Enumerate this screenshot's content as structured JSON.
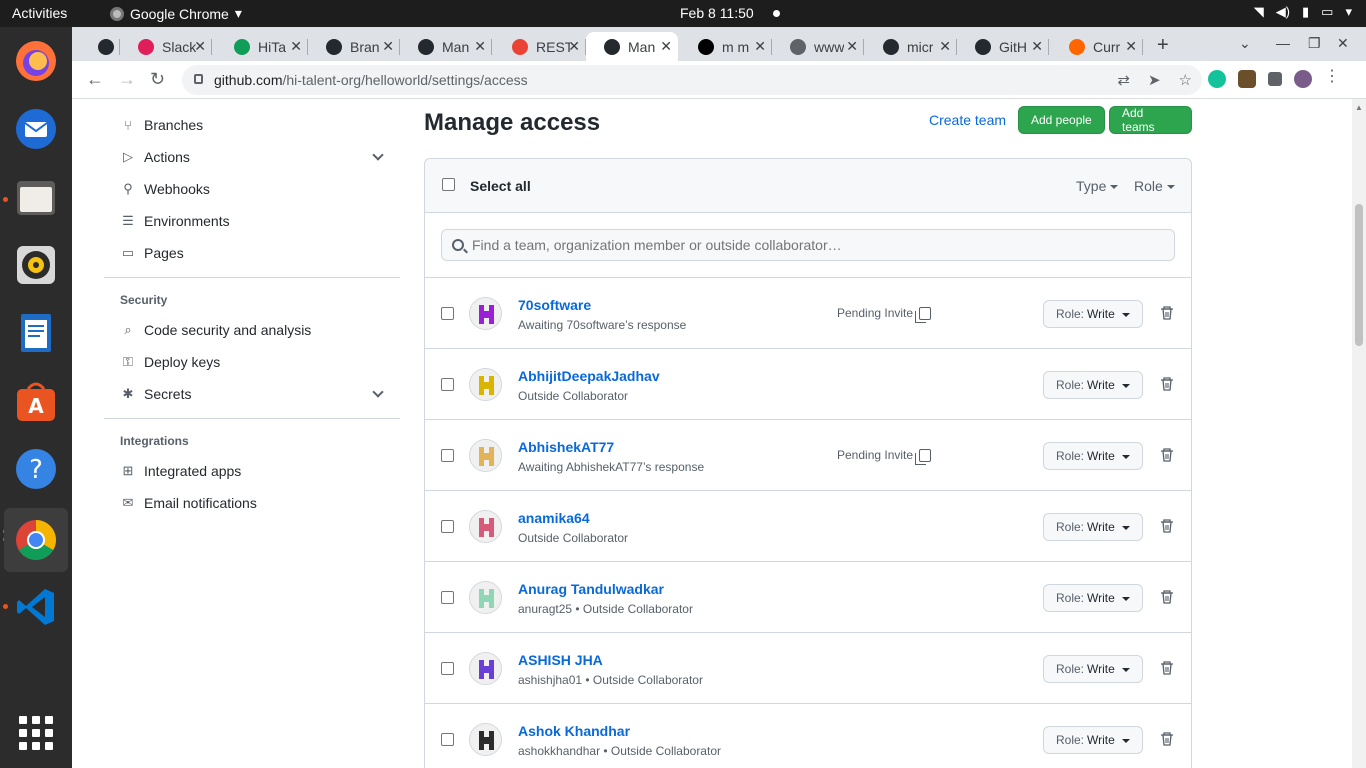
{
  "system": {
    "activities": "Activities",
    "app_name": "Google Chrome",
    "clock": "Feb 8  11:50"
  },
  "browser": {
    "tabs": [
      {
        "title": "",
        "icon": "github-icon",
        "color": "#24292f"
      },
      {
        "title": "Slack",
        "icon": "slack-icon",
        "color": "#e01e5a"
      },
      {
        "title": "HiTa",
        "icon": "sheets-icon",
        "color": "#0f9d58"
      },
      {
        "title": "Bran",
        "icon": "github-icon",
        "color": "#24292f"
      },
      {
        "title": "Man",
        "icon": "github-icon",
        "color": "#24292f"
      },
      {
        "title": "REST",
        "icon": "gmail-icon",
        "color": "#ea4335"
      },
      {
        "title": "Man",
        "icon": "github-icon",
        "color": "#24292f",
        "active": true
      },
      {
        "title": "m m",
        "icon": "m-icon",
        "color": "#000000"
      },
      {
        "title": "www",
        "icon": "globe-icon",
        "color": "#5f6368"
      },
      {
        "title": "micr",
        "icon": "github-icon",
        "color": "#24292f"
      },
      {
        "title": "GitH",
        "icon": "github-icon",
        "color": "#24292f"
      },
      {
        "title": "Curr",
        "icon": "ycombinator-icon",
        "color": "#ff6600"
      }
    ],
    "url_host": "github.com",
    "url_path": "/hi-talent-org/helloworld/settings/access"
  },
  "sidebar": {
    "items_top": [
      {
        "label": "Branches",
        "icon": "branch-icon"
      },
      {
        "label": "Actions",
        "icon": "play-icon",
        "expandable": true
      },
      {
        "label": "Webhooks",
        "icon": "webhook-icon"
      },
      {
        "label": "Environments",
        "icon": "server-icon"
      },
      {
        "label": "Pages",
        "icon": "browser-icon"
      }
    ],
    "security_heading": "Security",
    "security_items": [
      {
        "label": "Code security and analysis",
        "icon": "codescan-icon"
      },
      {
        "label": "Deploy keys",
        "icon": "key-icon"
      },
      {
        "label": "Secrets",
        "icon": "asterisk-icon",
        "expandable": true
      }
    ],
    "integrations_heading": "Integrations",
    "integrations_items": [
      {
        "label": "Integrated apps",
        "icon": "apps-icon"
      },
      {
        "label": "Email notifications",
        "icon": "mail-icon"
      }
    ]
  },
  "main": {
    "title": "Manage access",
    "create_team": "Create team",
    "add_people": "Add people",
    "add_teams": "Add teams",
    "select_all": "Select all",
    "filter_type": "Type",
    "filter_role": "Role",
    "search_placeholder": "Find a team, organization member or outside collaborator…",
    "pending_label": "Pending Invite",
    "role_prefix": "Role:",
    "members": [
      {
        "name": "70software",
        "sub": "Awaiting 70software’s response",
        "pending": true,
        "role": "Write",
        "avatar_color": "#9b1fd6"
      },
      {
        "name": "AbhijitDeepakJadhav",
        "sub": "Outside Collaborator",
        "pending": false,
        "role": "Write",
        "avatar_color": "#d9b400"
      },
      {
        "name": "AbhishekAT77",
        "sub": "Awaiting AbhishekAT77’s response",
        "pending": true,
        "role": "Write",
        "avatar_color": "#e3b35a"
      },
      {
        "name": "anamika64",
        "sub": "Outside Collaborator",
        "pending": false,
        "role": "Write",
        "avatar_color": "#d65a7a"
      },
      {
        "name": "Anurag Tandulwadkar",
        "sub": "anuragt25 • Outside Collaborator",
        "pending": false,
        "role": "Write",
        "avatar_color": "#8fd6b5"
      },
      {
        "name": "ASHISH JHA",
        "sub": "ashishjha01 • Outside Collaborator",
        "pending": false,
        "role": "Write",
        "avatar_color": "#6a3fd6"
      },
      {
        "name": "Ashok Khandhar",
        "sub": "ashokkhandhar • Outside Collaborator",
        "pending": false,
        "role": "Write",
        "avatar_color": "#2b2b2b"
      }
    ]
  },
  "colors": {
    "accent_green": "#2da44e",
    "link_blue": "#0969da"
  }
}
